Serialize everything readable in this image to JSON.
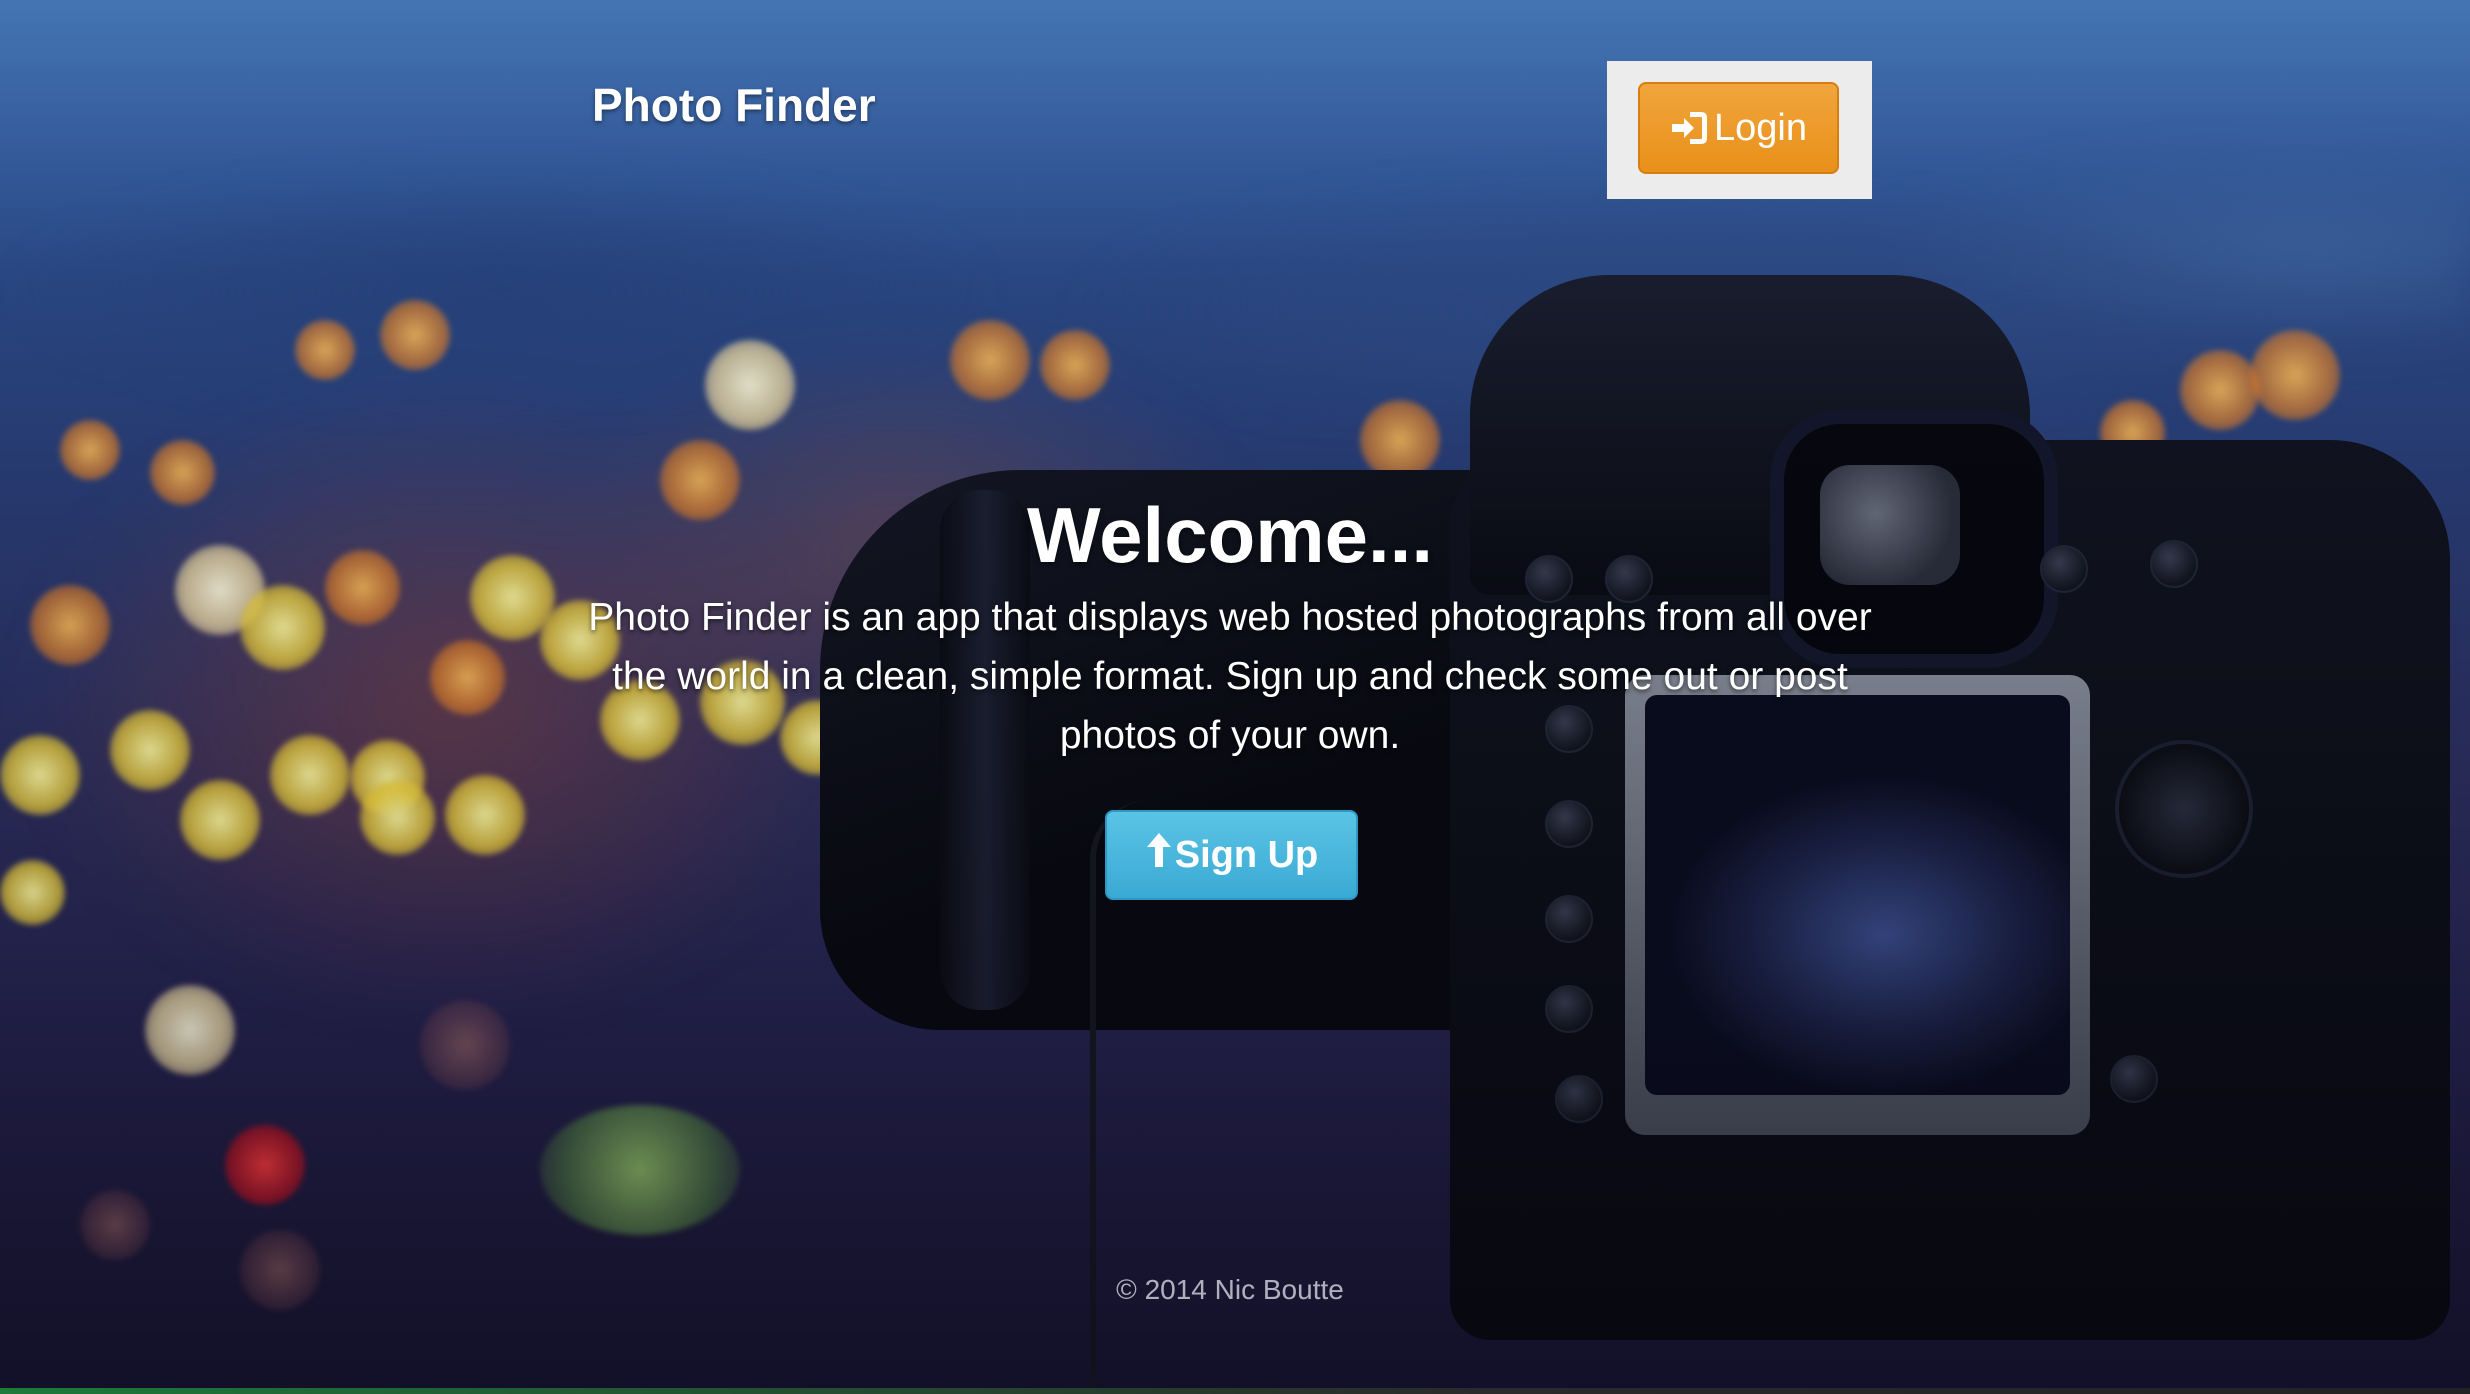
{
  "header": {
    "brand": "Photo Finder",
    "login_label": "Login",
    "login_icon": "sign-in-icon"
  },
  "hero": {
    "title": "Welcome...",
    "description": "Photo Finder is an app that displays web hosted photographs from all over the world in a clean, simple format. Sign up and check some out or post photos of your own.",
    "signup_label": "Sign Up",
    "signup_icon": "arrow-up-icon"
  },
  "footer": {
    "copyright": "© 2014 Nic Boutte"
  },
  "colors": {
    "login_button": "#ec9a2a",
    "signup_button": "#4ab6de",
    "login_container": "#ececec"
  }
}
